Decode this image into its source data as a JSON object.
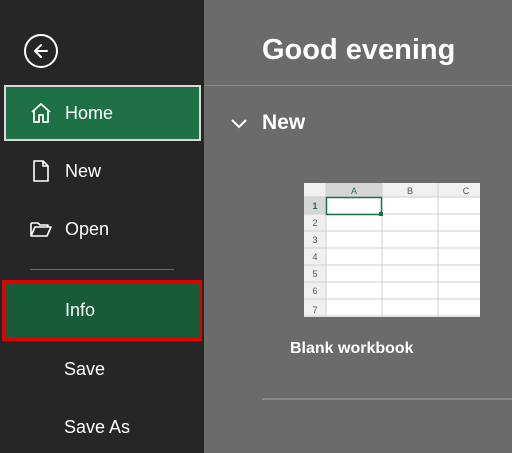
{
  "sidebar": {
    "back_label": "Back",
    "items": [
      {
        "label": "Home",
        "icon": "home-icon"
      },
      {
        "label": "New",
        "icon": "new-document-icon"
      },
      {
        "label": "Open",
        "icon": "open-folder-icon"
      },
      {
        "label": "Info"
      },
      {
        "label": "Save"
      },
      {
        "label": "Save As"
      }
    ]
  },
  "main": {
    "greeting": "Good evening",
    "section_title": "New",
    "templates": [
      {
        "label": "Blank workbook",
        "columns": [
          "A",
          "B",
          "C"
        ],
        "rows": [
          "1",
          "2",
          "3",
          "4",
          "5",
          "6",
          "7"
        ]
      }
    ]
  },
  "colors": {
    "sidebar_bg": "#262626",
    "main_bg": "#6b6b6b",
    "accent_green": "#1e7145",
    "selected_green": "#185c37",
    "highlight_red": "#e00000"
  }
}
